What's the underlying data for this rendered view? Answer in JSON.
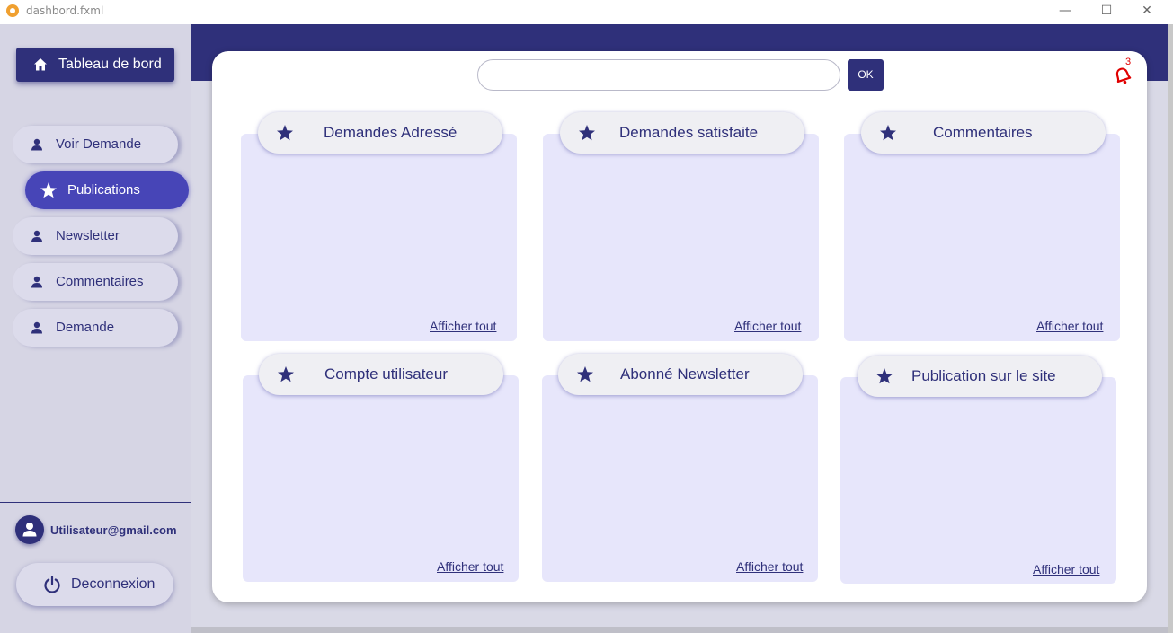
{
  "window": {
    "title": "dashbord.fxml"
  },
  "sidebar": {
    "dashboard_label": "Tableau de bord",
    "items": [
      {
        "label": "Voir Demande",
        "icon": "user-icon",
        "active": false
      },
      {
        "label": "Publications",
        "icon": "star-icon",
        "active": true
      },
      {
        "label": "Newsletter",
        "icon": "user-icon",
        "active": false
      },
      {
        "label": "Commentaires",
        "icon": "user-icon",
        "active": false
      },
      {
        "label": "Demande",
        "icon": "user-icon",
        "active": false
      }
    ],
    "user_email": "Utilisateur@gmail.com",
    "logout_label": "Deconnexion"
  },
  "header": {
    "search_value": "",
    "ok_label": "OK",
    "notification_count": "3"
  },
  "tiles": [
    {
      "title": "Demandes Adressé",
      "link": "Afficher tout"
    },
    {
      "title": "Demandes satisfaite",
      "link": "Afficher tout"
    },
    {
      "title": "Commentaires",
      "link": "Afficher tout"
    },
    {
      "title": "Compte utilisateur",
      "link": "Afficher tout"
    },
    {
      "title": "Abonné Newsletter",
      "link": "Afficher tout"
    },
    {
      "title": "Publication sur le site",
      "link": "Afficher tout"
    }
  ],
  "colors": {
    "primary": "#2f307a",
    "active_nav": "#4745b7",
    "tile_background": "#e7e6fb",
    "notification": "#e00000"
  }
}
